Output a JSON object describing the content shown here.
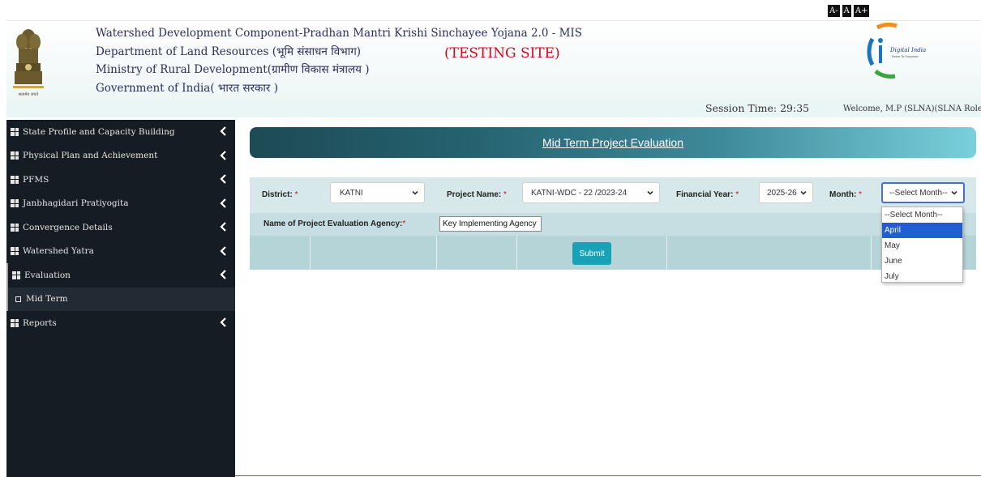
{
  "font_controls": [
    "A-",
    "A",
    "A+"
  ],
  "header": {
    "line1": "Watershed Development Component-Pradhan Mantri Krishi Sinchayee Yojana 2.0 - MIS",
    "line2": "Department of Land Resources (भूमि संसाधन विभाग)",
    "line3": "Ministry of Rural Development(ग्रामीण विकास मंत्रालय )",
    "line4": "Government of India( भारत सरकार )",
    "testing_label": "(TESTING SITE)",
    "emblem_caption": "सत्यमेव जयते",
    "digital_india": "Digital India",
    "digital_india_tagline": "Power To Empower"
  },
  "session": {
    "time_label": "Session Time: 29:35",
    "welcome": "Welcome, M.P (SLNA)(SLNA Role)"
  },
  "sidebar": {
    "items": [
      {
        "label": "State Profile and Capacity Building"
      },
      {
        "label": "Physical Plan and Achievement"
      },
      {
        "label": "PFMS"
      },
      {
        "label": "Janbhagidari Pratiyogita"
      },
      {
        "label": "Convergence Details"
      },
      {
        "label": "Watershed Yatra"
      },
      {
        "label": "Evaluation"
      },
      {
        "label": "Reports"
      }
    ],
    "sub_item": "Mid Term"
  },
  "page_title": "Mid Term Project Evaluation",
  "form": {
    "district_label": "District:",
    "district_value": "KATNI",
    "project_label": "Project Name:",
    "project_value": "KATNI-WDC - 22 /2023-24",
    "fy_label": "Financial Year:",
    "fy_value": "2025-26",
    "month_label": "Month:",
    "month_value": "--Select Month--",
    "agency_label": "Name of Project Evaluation Agency:",
    "agency_value": "Key Implementing Agency",
    "required_mark": "*",
    "submit_label": "Submit"
  },
  "month_options": [
    "--Select Month--",
    "April",
    "May",
    "June",
    "July"
  ],
  "colors": {
    "sidebar_bg": "#151c24",
    "accent": "#17a2b8",
    "highlight": "#1f5fd1",
    "testing_red": "#e3001b"
  }
}
